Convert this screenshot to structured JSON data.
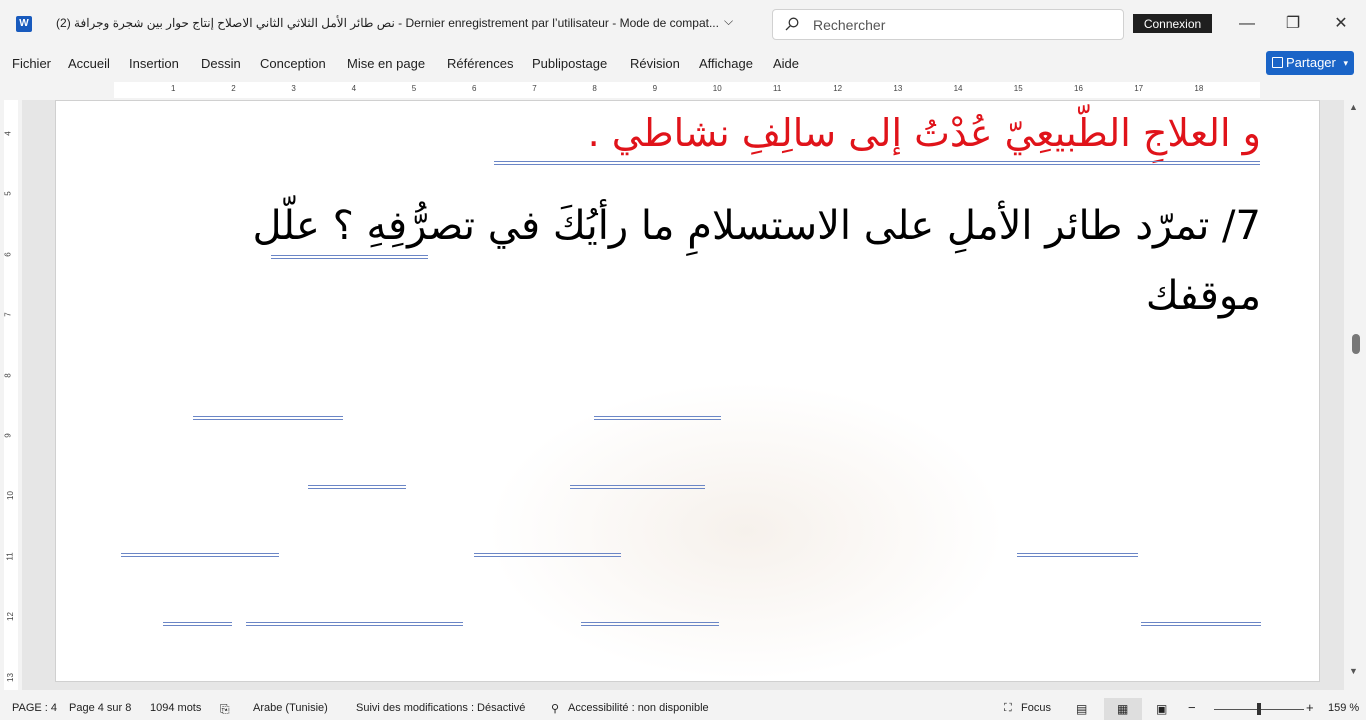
{
  "titlebar": {
    "app_icon_letter": "W",
    "doc_title": "نص طائر الأمل الثلاثي الثاني الاصلاح  إنتاج حوار بين شجرة وجرافة (2)  -  Dernier enregistrement par l’utilisateur  -  Mode de compat...",
    "search_placeholder": "Rechercher",
    "connexion_label": "Connexion"
  },
  "menu": {
    "items": [
      "Fichier",
      "Accueil",
      "Insertion",
      "Dessin",
      "Conception",
      "Mise en page",
      "Références",
      "Publipostage",
      "Révision",
      "Affichage",
      "Aide"
    ],
    "share_label": "Partager"
  },
  "ruler": {
    "h_labels": [
      "1",
      "2",
      "3",
      "4",
      "5",
      "6",
      "7",
      "8",
      "9",
      "10",
      "11",
      "12",
      "13",
      "14",
      "15",
      "16",
      "17",
      "18"
    ],
    "v_labels": [
      "4",
      "5",
      "6",
      "7",
      "8",
      "9",
      "10",
      "11",
      "12",
      "13"
    ]
  },
  "document": {
    "red_line": "و العلاجِ الطّبيعِيّ عُدْتُ إلى  سالِفِ نشاطي .",
    "question_line1": "7/ تمرّد طائر الأملِ على الاستسلامِ ما رأيُكَ في تصرُّفِهِ ؟ علّل",
    "question_line2": "موقفك"
  },
  "status": {
    "page": "PAGE : 4",
    "page_of": "Page 4 sur 8",
    "words": "1094 mots",
    "language": "Arabe (Tunisie)",
    "track_changes": "Suivi des modifications : Désactivé",
    "accessibility": "Accessibilité : non disponible",
    "focus": "Focus",
    "zoom_minus": "−",
    "zoom_plus": "+",
    "zoom": "159 %"
  },
  "colors": {
    "accent": "#1a64c7",
    "red_text": "#e0131a",
    "underline": "#6b86c6"
  }
}
